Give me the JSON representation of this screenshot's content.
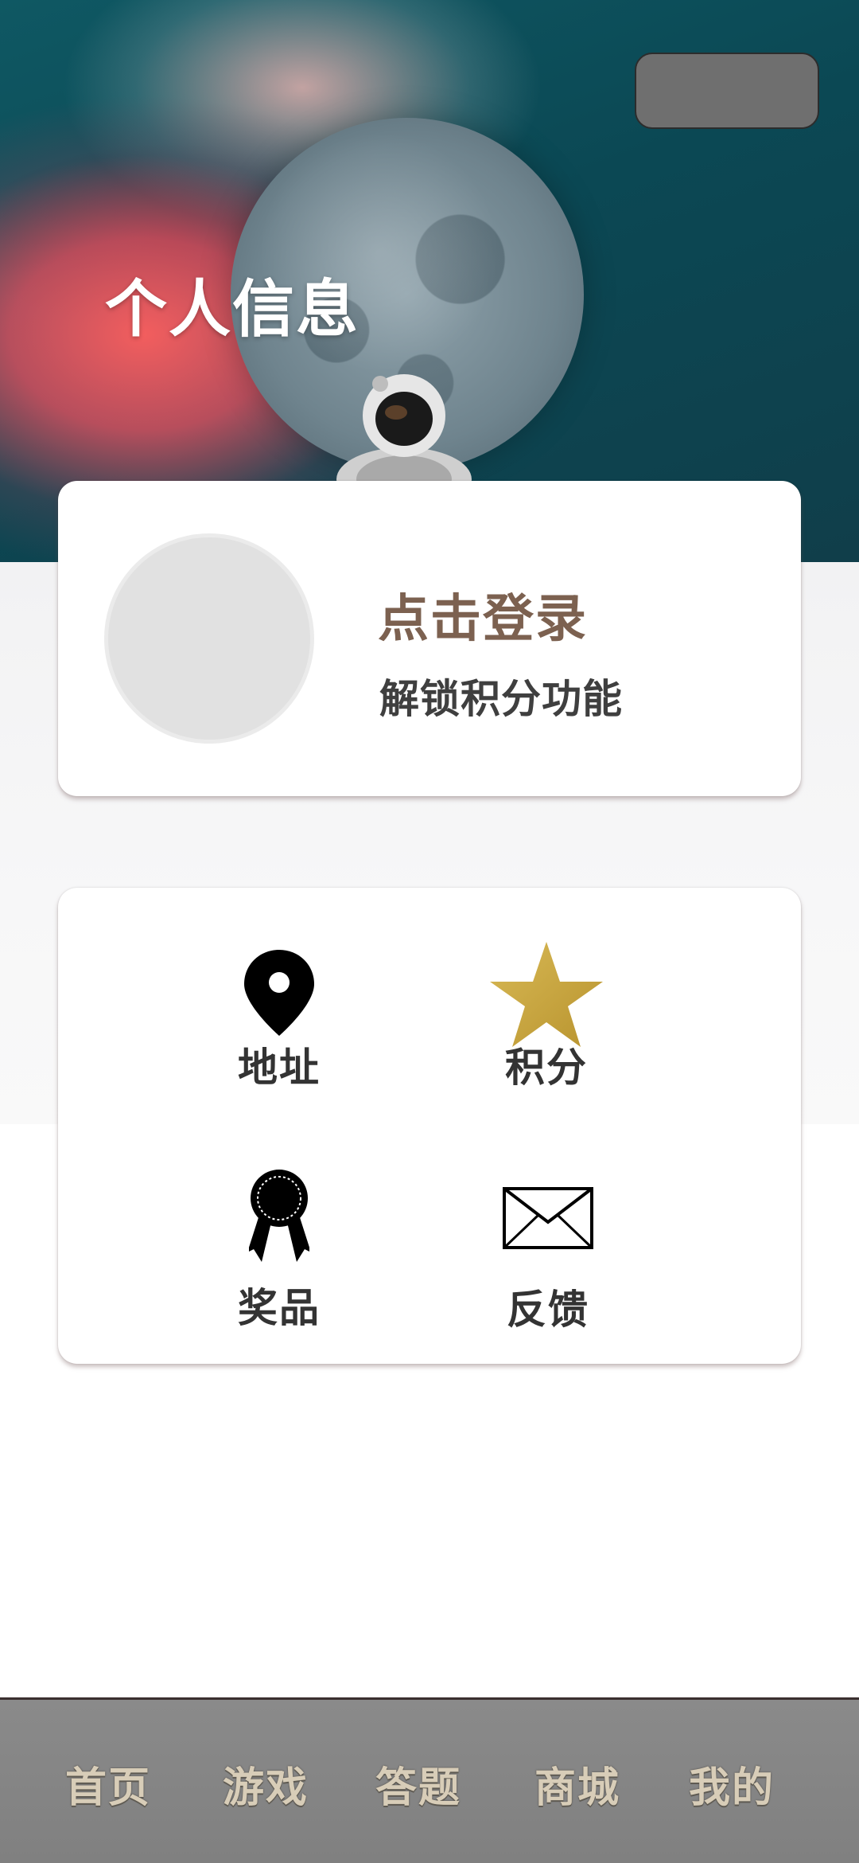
{
  "header": {
    "title": "个人信息"
  },
  "login_card": {
    "title": "点击登录",
    "subtitle": "解锁积分功能"
  },
  "menu": {
    "items": [
      {
        "label": "地址",
        "icon": "location-pin-icon"
      },
      {
        "label": "积分",
        "icon": "star-icon"
      },
      {
        "label": "奖品",
        "icon": "award-ribbon-icon"
      },
      {
        "label": "反馈",
        "icon": "envelope-icon"
      }
    ]
  },
  "bottom_nav": {
    "items": [
      {
        "label": "首页"
      },
      {
        "label": "游戏"
      },
      {
        "label": "答题"
      },
      {
        "label": "商城"
      },
      {
        "label": "我的"
      }
    ]
  },
  "colors": {
    "star": "#c9a640",
    "login_title": "#7c6150",
    "nav_text": "#d8cdb8",
    "nav_bg": "#858585"
  }
}
